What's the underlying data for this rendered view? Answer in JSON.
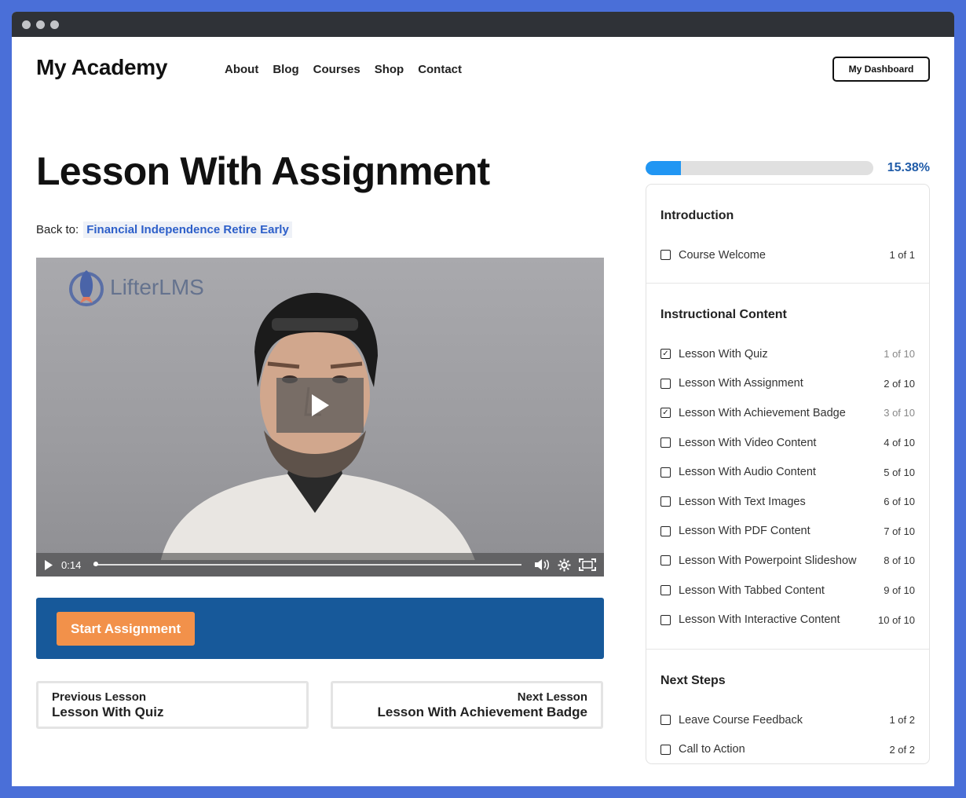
{
  "header": {
    "logo": "My Academy",
    "nav": [
      "About",
      "Blog",
      "Courses",
      "Shop",
      "Contact"
    ],
    "dashboard_button": "My Dashboard"
  },
  "lesson": {
    "title": "Lesson With Assignment",
    "back_label": "Back to:",
    "back_link": "Financial Independence Retire Early"
  },
  "video": {
    "brand": "LifterLMS",
    "time": "0:14",
    "progress": 0
  },
  "assignment": {
    "button_label": "Start Assignment",
    "bar_color": "#17599a",
    "button_color": "#f2914a"
  },
  "lesson_nav": {
    "previous": {
      "label": "Previous Lesson",
      "name": "Lesson With Quiz"
    },
    "next": {
      "label": "Next Lesson",
      "name": "Lesson With Achievement Badge"
    }
  },
  "progress": {
    "percent_text": "15.38%",
    "fraction": 0.1538,
    "fill_color": "#2196f3"
  },
  "outline": {
    "sections": [
      {
        "title": "Introduction",
        "items": [
          {
            "name": "Course Welcome",
            "count": "1 of 1",
            "completed": false
          }
        ]
      },
      {
        "title": "Instructional Content",
        "items": [
          {
            "name": "Lesson With Quiz",
            "count": "1 of 10",
            "completed": true
          },
          {
            "name": "Lesson With Assignment",
            "count": "2 of 10",
            "completed": false
          },
          {
            "name": "Lesson With Achievement Badge",
            "count": "3 of 10",
            "completed": true
          },
          {
            "name": "Lesson With Video Content",
            "count": "4 of 10",
            "completed": false
          },
          {
            "name": "Lesson With Audio Content",
            "count": "5 of 10",
            "completed": false
          },
          {
            "name": "Lesson With Text Images",
            "count": "6 of 10",
            "completed": false
          },
          {
            "name": "Lesson With PDF Content",
            "count": "7 of 10",
            "completed": false
          },
          {
            "name": "Lesson With Powerpoint Slideshow",
            "count": "8 of 10",
            "completed": false
          },
          {
            "name": "Lesson With Tabbed Content",
            "count": "9 of 10",
            "completed": false
          },
          {
            "name": "Lesson With Interactive Content",
            "count": "10 of 10",
            "completed": false
          }
        ]
      },
      {
        "title": "Next Steps",
        "items": [
          {
            "name": "Leave Course Feedback",
            "count": "1 of 2",
            "completed": false
          },
          {
            "name": "Call to Action",
            "count": "2 of 2",
            "completed": false
          }
        ]
      }
    ]
  }
}
